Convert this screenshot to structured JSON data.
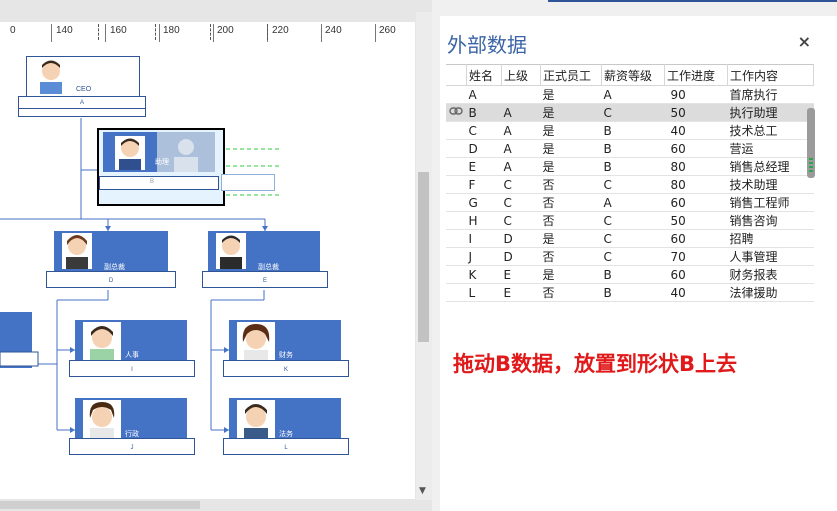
{
  "ruler": {
    "labels": [
      "0",
      "140",
      "160",
      "180",
      "200",
      "220",
      "240",
      "260"
    ]
  },
  "org": {
    "ceo": {
      "title": "CEO",
      "code": "A"
    },
    "b": {
      "title": "助理",
      "code": "B"
    },
    "d": {
      "title": "副总裁",
      "code": "D"
    },
    "e": {
      "title": "副总裁",
      "code": "E"
    },
    "i": {
      "title": "人事",
      "code": "I"
    },
    "k": {
      "title": "财务",
      "code": "K"
    },
    "j": {
      "title": "行政",
      "code": "J"
    },
    "l": {
      "title": "法务",
      "code": "L"
    }
  },
  "panel": {
    "title": "外部数据",
    "close": "×",
    "columns": [
      "姓名",
      "上级",
      "正式员工",
      "薪资等级",
      "工作进度",
      "工作内容"
    ],
    "selected_row": 1,
    "linked_row_icon": "link-icon",
    "rows": [
      [
        "A",
        "",
        "是",
        "A",
        "90",
        "首席执行"
      ],
      [
        "B",
        "A",
        "是",
        "C",
        "50",
        "执行助理"
      ],
      [
        "C",
        "A",
        "是",
        "B",
        "40",
        "技术总工"
      ],
      [
        "D",
        "A",
        "是",
        "B",
        "60",
        "营运"
      ],
      [
        "E",
        "A",
        "是",
        "B",
        "80",
        "销售总经理"
      ],
      [
        "F",
        "C",
        "否",
        "C",
        "80",
        "技术助理"
      ],
      [
        "G",
        "C",
        "否",
        "A",
        "60",
        "销售工程师"
      ],
      [
        "H",
        "C",
        "否",
        "C",
        "50",
        "销售咨询"
      ],
      [
        "I",
        "D",
        "是",
        "C",
        "60",
        "招聘"
      ],
      [
        "J",
        "D",
        "否",
        "C",
        "70",
        "人事管理"
      ],
      [
        "K",
        "E",
        "是",
        "B",
        "60",
        "财务报表"
      ],
      [
        "L",
        "E",
        "否",
        "B",
        "40",
        "法律援助"
      ]
    ]
  },
  "annotation": "拖动B数据，放置到形状B上去",
  "colors": {
    "accent": "#4472c4",
    "accent_dark": "#2f5597",
    "annotation": "#e01a1a",
    "panel_title": "#3b64a6"
  }
}
